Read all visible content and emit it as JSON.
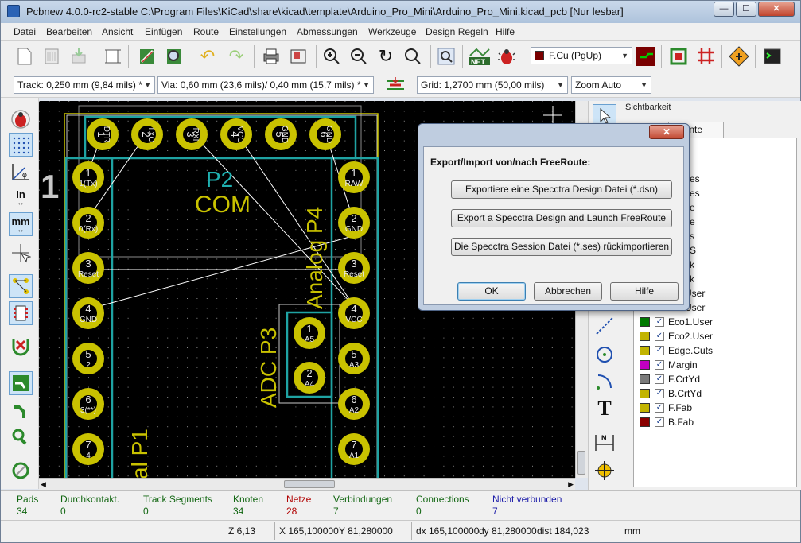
{
  "window": {
    "title": "Pcbnew 4.0.0-rc2-stable C:\\Program Files\\KiCad\\share\\kicad\\template\\Arduino_Pro_Mini\\Arduino_Pro_Mini.kicad_pcb [Nur lesbar]",
    "min": "—",
    "max": "☐",
    "close": "✕"
  },
  "menu": [
    "Datei",
    "Bearbeiten",
    "Ansicht",
    "Einfügen",
    "Route",
    "Einstellungen",
    "Abmessungen",
    "Werkzeuge",
    "Design Regeln",
    "Hilfe"
  ],
  "toolbar": {
    "layer_select": "F.Cu (PgUp)",
    "layer_color": "#7a0000"
  },
  "toolbar2": {
    "track": "Track: 0,250 mm (9,84 mils) *",
    "via": "Via: 0,60 mm (23,6 mils)/ 0,40 mm (15,7 mils) *",
    "grid": "Grid: 1,2700 mm (50,00 mils)",
    "zoom": "Zoom Auto"
  },
  "left_toolbar": {
    "inch_label": "In",
    "mm_label": "mm"
  },
  "canvas": {
    "text_1": "1",
    "p2": "P2",
    "com": "COM",
    "p4": "Analog P4",
    "p3": "ADC P3",
    "p1": "al P1",
    "top_pads": [
      {
        "num": "1",
        "net": "DTR"
      },
      {
        "num": "2",
        "net": "TXO"
      },
      {
        "num": "3",
        "net": "RXI"
      },
      {
        "num": "4",
        "net": "VCC"
      },
      {
        "num": "5",
        "net": "GND"
      },
      {
        "num": "6",
        "net": "GND"
      }
    ],
    "left_pads": [
      {
        "num": "1",
        "net": "1(Tx)"
      },
      {
        "num": "2",
        "net": "0(Rx)"
      },
      {
        "num": "3",
        "net": "Reset"
      },
      {
        "num": "4",
        "net": "GND"
      },
      {
        "num": "5",
        "net": "2"
      },
      {
        "num": "6",
        "net": "3(**)"
      },
      {
        "num": "7",
        "net": "4"
      }
    ],
    "right_pads": [
      {
        "num": "1",
        "net": "RAW"
      },
      {
        "num": "2",
        "net": "GND"
      },
      {
        "num": "3",
        "net": "Reset"
      },
      {
        "num": "4",
        "net": "VCC"
      },
      {
        "num": "5",
        "net": "A3"
      },
      {
        "num": "6",
        "net": "A2"
      },
      {
        "num": "7",
        "net": "A1"
      }
    ],
    "adc_pads": [
      {
        "num": "1",
        "net": "A5"
      },
      {
        "num": "2",
        "net": "A4"
      }
    ]
  },
  "panel": {
    "title": "Sichtbarkeit",
    "tab_visible_text": "nente",
    "partial_rows": [
      "es",
      "es",
      "e",
      "e",
      "s",
      "S",
      "k",
      "k",
      "User",
      "User"
    ],
    "layers": [
      {
        "name": "Eco1.User",
        "color": "#007a00"
      },
      {
        "name": "Eco2.User",
        "color": "#c2b400"
      },
      {
        "name": "Edge.Cuts",
        "color": "#c2b400"
      },
      {
        "name": "Margin",
        "color": "#c000c0"
      },
      {
        "name": "F.CrtYd",
        "color": "#7a7a7a"
      },
      {
        "name": "B.CrtYd",
        "color": "#c2b400"
      },
      {
        "name": "F.Fab",
        "color": "#c2b400"
      },
      {
        "name": "B.Fab",
        "color": "#8a0000"
      }
    ],
    "check": "✓"
  },
  "dialog": {
    "close": "✕",
    "heading": "Export/Import von/nach FreeRoute:",
    "btn_export": "Exportiere eine Specctra Design Datei (*.dsn)",
    "btn_launch": "Export a Specctra Design and Launch FreeRoute",
    "btn_import": "Die Specctra Session Datei (*.ses) rückimportieren",
    "ok": "OK",
    "cancel": "Abbrechen",
    "help": "Hilfe"
  },
  "status": [
    {
      "key": "Pads",
      "value": "34",
      "color": "#116611"
    },
    {
      "key": "Durchkontakt.",
      "value": "0",
      "color": "#116611"
    },
    {
      "key": "Track Segments",
      "value": "0",
      "color": "#116611"
    },
    {
      "key": "Knoten",
      "value": "34",
      "color": "#116611"
    },
    {
      "key": "Netze",
      "value": "28",
      "color": "#b00000"
    },
    {
      "key": "Verbindungen",
      "value": "7",
      "color": "#116611"
    },
    {
      "key": "Connections",
      "value": "0",
      "color": "#116611"
    },
    {
      "key": "Nicht verbunden",
      "value": "7",
      "color": "#1a1aa8"
    }
  ],
  "coords": {
    "zoom": "Z 6,13",
    "x": "X 165,100000",
    "y": "Y 81,280000",
    "dx": "dx 165,100000",
    "dy": "dy 81,280000",
    "dist": "dist 184,023",
    "unit": "mm"
  }
}
